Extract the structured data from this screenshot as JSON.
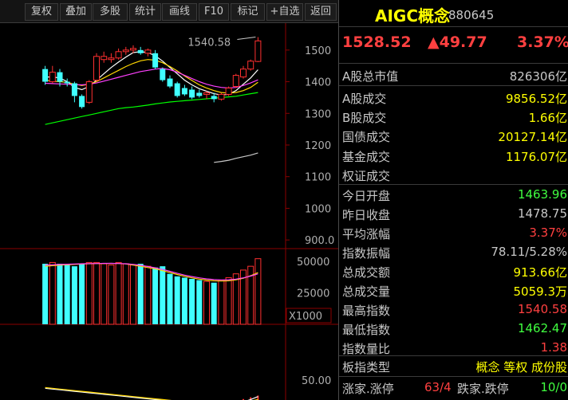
{
  "toolbar": {
    "buttons": [
      "复权",
      "叠加",
      "多股",
      "统计",
      "画线",
      "F10",
      "标记",
      "+自选",
      "返回"
    ]
  },
  "chart": {
    "max_label": "1540.58",
    "price_ticks": [
      "1500",
      "1400",
      "1300",
      "1200",
      "1100",
      "1000",
      "900.0"
    ],
    "volume_ticks": [
      "50000",
      "25000"
    ],
    "volume_unit": "X1000",
    "indicator_tick": "50.00"
  },
  "chart_data": {
    "type": "candlestick",
    "price_ylim": [
      850,
      1560
    ],
    "candles": [
      {
        "o": 1440,
        "c": 1400,
        "h": 1450,
        "l": 1390
      },
      {
        "o": 1400,
        "c": 1430,
        "h": 1450,
        "l": 1395
      },
      {
        "o": 1430,
        "c": 1400,
        "h": 1440,
        "l": 1385
      },
      {
        "o": 1400,
        "c": 1395,
        "h": 1410,
        "l": 1385
      },
      {
        "o": 1395,
        "c": 1355,
        "h": 1400,
        "l": 1335
      },
      {
        "o": 1355,
        "c": 1320,
        "h": 1360,
        "l": 1315
      },
      {
        "o": 1335,
        "c": 1400,
        "h": 1405,
        "l": 1330
      },
      {
        "o": 1405,
        "c": 1480,
        "h": 1490,
        "l": 1400
      },
      {
        "o": 1470,
        "c": 1480,
        "h": 1495,
        "l": 1460
      },
      {
        "o": 1470,
        "c": 1475,
        "h": 1490,
        "l": 1460
      },
      {
        "o": 1475,
        "c": 1495,
        "h": 1505,
        "l": 1470
      },
      {
        "o": 1495,
        "c": 1500,
        "h": 1510,
        "l": 1485
      },
      {
        "o": 1500,
        "c": 1505,
        "h": 1515,
        "l": 1490
      },
      {
        "o": 1500,
        "c": 1490,
        "h": 1510,
        "l": 1485
      },
      {
        "o": 1490,
        "c": 1500,
        "h": 1505,
        "l": 1480
      },
      {
        "o": 1490,
        "c": 1445,
        "h": 1500,
        "l": 1440
      },
      {
        "o": 1440,
        "c": 1405,
        "h": 1445,
        "l": 1400
      },
      {
        "o": 1410,
        "c": 1385,
        "h": 1420,
        "l": 1380
      },
      {
        "o": 1395,
        "c": 1355,
        "h": 1400,
        "l": 1350
      },
      {
        "o": 1380,
        "c": 1360,
        "h": 1390,
        "l": 1355
      },
      {
        "o": 1375,
        "c": 1350,
        "h": 1385,
        "l": 1345
      },
      {
        "o": 1365,
        "c": 1355,
        "h": 1375,
        "l": 1350
      },
      {
        "o": 1360,
        "c": 1365,
        "h": 1370,
        "l": 1345
      },
      {
        "o": 1355,
        "c": 1345,
        "h": 1365,
        "l": 1335
      },
      {
        "o": 1345,
        "c": 1360,
        "h": 1365,
        "l": 1340
      },
      {
        "o": 1360,
        "c": 1380,
        "h": 1385,
        "l": 1355
      },
      {
        "o": 1385,
        "c": 1420,
        "h": 1425,
        "l": 1380
      },
      {
        "o": 1415,
        "c": 1440,
        "h": 1450,
        "l": 1410
      },
      {
        "o": 1440,
        "c": 1465,
        "h": 1470,
        "l": 1435
      },
      {
        "o": 1464,
        "c": 1529,
        "h": 1541,
        "l": 1462
      }
    ],
    "ma_lines": [
      {
        "color": "#ffffff",
        "values": [
          1415,
          1415,
          1412,
          1400,
          1382,
          1375,
          1385,
          1405,
          1425,
          1445,
          1462,
          1478,
          1492,
          1495,
          1492,
          1482,
          1465,
          1445,
          1425,
          1405,
          1390,
          1378,
          1370,
          1362,
          1358,
          1360,
          1372,
          1392,
          1412,
          1438
        ]
      },
      {
        "color": "#ffd700",
        "values": [
          1405,
          1402,
          1400,
          1398,
          1392,
          1388,
          1392,
          1400,
          1412,
          1424,
          1436,
          1448,
          1458,
          1466,
          1470,
          1468,
          1460,
          1448,
          1434,
          1418,
          1404,
          1390,
          1380,
          1372,
          1366,
          1364,
          1366,
          1372,
          1382,
          1398
        ]
      },
      {
        "color": "#ff40ff",
        "values": [
          1395,
          1394,
          1393,
          1392,
          1391,
          1390,
          1392,
          1396,
          1402,
          1408,
          1414,
          1420,
          1426,
          1432,
          1436,
          1440,
          1442,
          1438,
          1430,
          1420,
          1410,
          1400,
          1392,
          1386,
          1382,
          1380,
          1382,
          1388,
          1396,
          1406
        ]
      },
      {
        "color": "#00ff00",
        "values": [
          1265,
          1270,
          1275,
          1280,
          1285,
          1290,
          1295,
          1300,
          1305,
          1310,
          1315,
          1318,
          1320,
          1323,
          1326,
          1330,
          1333,
          1336,
          1338,
          1340,
          1342,
          1344,
          1346,
          1348,
          1350,
          1352,
          1354,
          1358,
          1362,
          1366
        ]
      }
    ],
    "extra_line": {
      "color": "#c8c8c8",
      "values_from_index": 23,
      "values": [
        1145,
        1148,
        1152,
        1158,
        1163,
        1168,
        1175
      ]
    },
    "volume_ylim": [
      0,
      60000
    ],
    "volumes": [
      48000,
      49000,
      48000,
      47000,
      46000,
      48000,
      49000,
      49000,
      48000,
      47000,
      49000,
      48000,
      47000,
      48000,
      46000,
      45000,
      46000,
      40000,
      38000,
      37000,
      36000,
      35000,
      34000,
      33000,
      35000,
      37000,
      40000,
      43000,
      46000,
      52000
    ],
    "volume_ma": [
      {
        "color": "#ffd700",
        "values": [
          46000,
          46500,
          47000,
          47200,
          47500,
          47800,
          48000,
          48100,
          48200,
          48300,
          48200,
          47800,
          47000,
          46000,
          45000,
          44000,
          42500,
          41000,
          39500,
          38000,
          36800,
          35800,
          35000,
          34500,
          34300,
          34500,
          35300,
          36500,
          38500,
          41000
        ]
      },
      {
        "color": "#ff40ff",
        "values": [
          47000,
          47200,
          47400,
          47600,
          47800,
          48000,
          48100,
          48200,
          48300,
          48300,
          48200,
          48000,
          47500,
          46800,
          45800,
          44800,
          43500,
          42000,
          40500,
          39000,
          37800,
          36800,
          36000,
          35500,
          35200,
          35300,
          35800,
          36800,
          38200,
          40000
        ]
      }
    ],
    "indicator_ylim": [
      0,
      100
    ],
    "indicator_lines": [
      {
        "color": "#ffffff",
        "values": [
          39,
          38,
          37,
          36,
          35,
          34,
          33,
          32,
          31,
          30,
          29,
          28,
          27,
          26,
          25,
          24,
          23,
          22,
          21,
          20,
          19,
          18,
          17,
          16,
          16,
          17,
          19,
          21,
          24,
          28
        ]
      },
      {
        "color": "#ffd700",
        "values": [
          40,
          39,
          38,
          37,
          36,
          35,
          34,
          33,
          32,
          31,
          30,
          29,
          28,
          27,
          26,
          25,
          24,
          23,
          22,
          21,
          20,
          20,
          19,
          19,
          18,
          18,
          19,
          20,
          22,
          24
        ]
      }
    ],
    "indicator_bars": [
      0,
      0,
      0,
      0,
      0,
      0,
      0,
      0,
      0,
      0,
      0,
      0,
      0,
      0,
      0,
      0,
      -2,
      -3,
      -4,
      -4,
      -5,
      -5,
      -4,
      -3,
      -2,
      -1,
      1,
      2,
      3,
      4
    ]
  },
  "panel": {
    "title": "AIGC概念",
    "code": "880645",
    "price": "1528.52",
    "change": "▲49.77",
    "pct": "3.37%",
    "rows1": [
      {
        "label": "A股总市值",
        "value": "826306亿",
        "color": "#c8c8c8"
      }
    ],
    "rows2": [
      {
        "label": "A股成交",
        "value": "9856.52亿",
        "color": "#ffff00"
      },
      {
        "label": "B股成交",
        "value": "1.66亿",
        "color": "#ffff00"
      },
      {
        "label": "国债成交",
        "value": "20127.14亿",
        "color": "#ffff00"
      },
      {
        "label": "基金成交",
        "value": "1176.07亿",
        "color": "#ffff00"
      },
      {
        "label": "权证成交",
        "value": "",
        "color": "#ffff00"
      }
    ],
    "rows3": [
      {
        "label": "今日开盘",
        "value": "1463.96",
        "color": "#40ff40"
      },
      {
        "label": "昨日收盘",
        "value": "1478.75",
        "color": "#c8c8c8"
      },
      {
        "label": "平均涨幅",
        "value": "3.37%",
        "color": "#ff4040"
      },
      {
        "label": "指数振幅",
        "value": "78.11/5.28%",
        "color": "#c8c8c8"
      },
      {
        "label": "总成交额",
        "value": "913.66亿",
        "color": "#ffff00"
      },
      {
        "label": "总成交量",
        "value": "5059.3万",
        "color": "#ffff00"
      },
      {
        "label": "最高指数",
        "value": "1540.58",
        "color": "#ff4040"
      },
      {
        "label": "最低指数",
        "value": "1462.47",
        "color": "#40ff40"
      },
      {
        "label": "指数量比",
        "value": "1.38",
        "color": "#ff4040"
      }
    ],
    "board_type_label": "板指类型",
    "board_type_value": "概念 等权 成份股",
    "bottom_label": "涨家.涨停",
    "bottom_up": "63/4",
    "bottom_mid_label": "跌家.跌停",
    "bottom_down": "10/0"
  }
}
